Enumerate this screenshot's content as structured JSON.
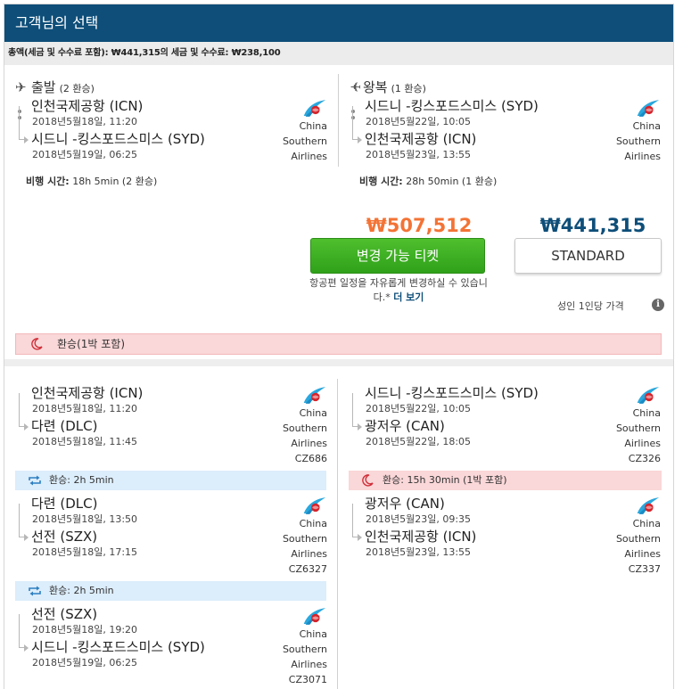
{
  "header": {
    "title": "고객님의 선택"
  },
  "price_summary": "총액(세금 및 수수료 포함): ₩441,315의 세금 및 수수료: ₩238,100",
  "outbound": {
    "title": "출발",
    "stops": "(2 환승)",
    "from_city": "인천국제공항 (ICN)",
    "from_time": "2018년5월18일, 11:20",
    "to_city": "시드니 -킹스포드스미스 (SYD)",
    "to_time": "2018년5월19일, 06:25",
    "airline_lines": [
      "China",
      "Southern",
      "Airlines"
    ],
    "duration_label": "비행 시간:",
    "duration_value": "18h 5min (2 환승)"
  },
  "inbound": {
    "title": "왕복",
    "stops": "(1 환승)",
    "from_city": "시드니 -킹스포드스미스 (SYD)",
    "from_time": "2018년5월22일, 10:05",
    "to_city": "인천국제공항 (ICN)",
    "to_time": "2018년5월23일, 13:55",
    "airline_lines": [
      "China",
      "Southern",
      "Airlines"
    ],
    "duration_label": "비행 시간:",
    "duration_value": "28h 50min (1 환승)"
  },
  "fares": {
    "flex_price": "₩507,512",
    "flex_button": "변경 가능 티켓",
    "flex_note": "항공편 일정을 자유롭게 변경하실 수 있습니다.*",
    "flex_more": "더 보기",
    "standard_price": "₩441,315",
    "standard_button": "STANDARD",
    "per_adult": "성인 1인당 가격",
    "info_icon": "i"
  },
  "overnight_banner": "환승(1박 포함)",
  "outbound_segments": [
    {
      "from_city": "인천국제공항 (ICN)",
      "from_time": "2018년5월18일, 11:20",
      "to_city": "다련 (DLC)",
      "to_time": "2018년5월18일, 11:45",
      "airline_lines": [
        "China",
        "Southern",
        "Airlines"
      ],
      "flight_no": "CZ686"
    },
    {
      "from_city": "다련 (DLC)",
      "from_time": "2018년5월18일, 13:50",
      "to_city": "선전 (SZX)",
      "to_time": "2018년5월18일, 17:15",
      "airline_lines": [
        "China",
        "Southern",
        "Airlines"
      ],
      "flight_no": "CZ6327"
    },
    {
      "from_city": "선전 (SZX)",
      "from_time": "2018년5월18일, 19:20",
      "to_city": "시드니 -킹스포드스미스 (SYD)",
      "to_time": "2018년5월19일, 06:25",
      "airline_lines": [
        "China",
        "Southern",
        "Airlines"
      ],
      "flight_no": "CZ3071"
    }
  ],
  "outbound_layovers": [
    "환승: 2h 5min",
    "환승: 2h 5min"
  ],
  "inbound_segments": [
    {
      "from_city": "시드니 -킹스포드스미스 (SYD)",
      "from_time": "2018년5월22일, 10:05",
      "to_city": "광저우 (CAN)",
      "to_time": "2018년5월22일, 18:05",
      "airline_lines": [
        "China",
        "Southern",
        "Airlines"
      ],
      "flight_no": "CZ326"
    },
    {
      "from_city": "광저우 (CAN)",
      "from_time": "2018년5월23일, 09:35",
      "to_city": "인천국제공항 (ICN)",
      "to_time": "2018년5월23일, 13:55",
      "airline_lines": [
        "China",
        "Southern",
        "Airlines"
      ],
      "flight_no": "CZ337"
    }
  ],
  "inbound_layover": "환승: 15h 30min  (1박 포함)",
  "colors": {
    "header_bg": "#0e4e79",
    "flex_price": "#f37335",
    "flex_button": "#3aab1f",
    "standard_price": "#0e4e79",
    "overnight_bg": "#fad7d8",
    "layover_bg": "#dcedfb"
  }
}
